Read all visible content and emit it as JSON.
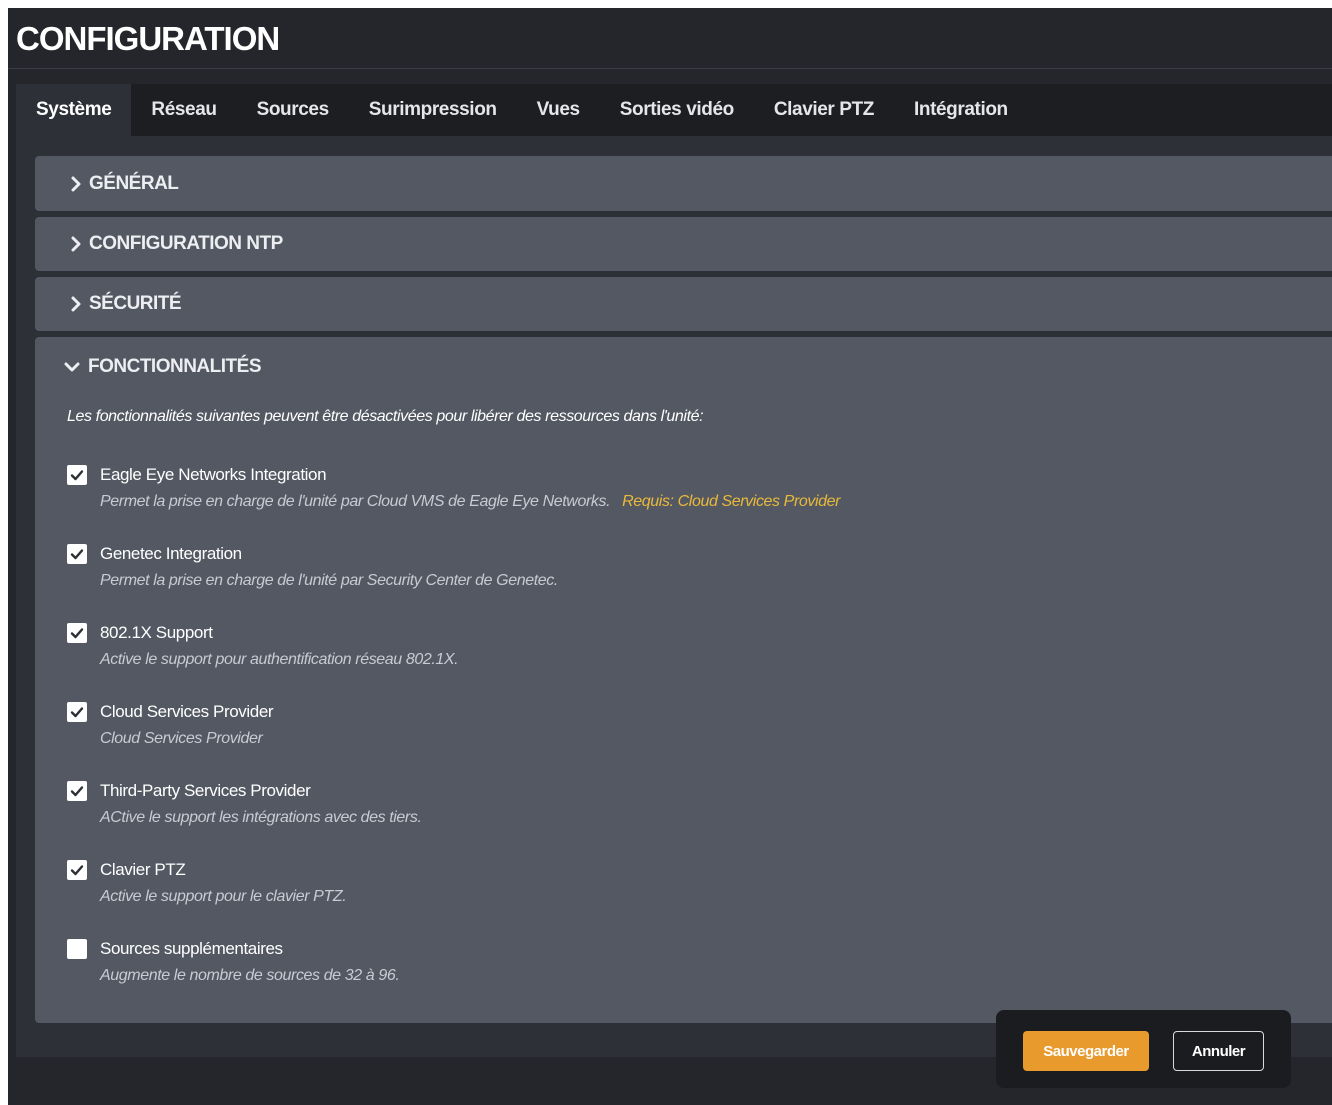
{
  "header": {
    "title": "CONFIGURATION"
  },
  "tabs": [
    {
      "label": "Système",
      "active": true
    },
    {
      "label": "Réseau"
    },
    {
      "label": "Sources"
    },
    {
      "label": "Surimpression"
    },
    {
      "label": "Vues"
    },
    {
      "label": "Sorties vidéo"
    },
    {
      "label": "Clavier PTZ"
    },
    {
      "label": "Intégration"
    }
  ],
  "sections": {
    "general": {
      "title": "GÉNÉRAL",
      "icon": "chevron-right-icon",
      "expanded": false
    },
    "ntp": {
      "title": "CONFIGURATION NTP",
      "icon": "chevron-right-icon",
      "expanded": false
    },
    "security": {
      "title": "SÉCURITÉ",
      "icon": "chevron-right-icon",
      "expanded": false
    },
    "features": {
      "title": "FONCTIONNALITÉS",
      "icon": "chevron-down-icon",
      "expanded": true,
      "intro": "Les fonctionnalités suivantes peuvent être désactivées pour libérer des ressources dans l'unité:",
      "items": [
        {
          "label": "Eagle Eye Networks Integration",
          "checked": true,
          "description": "Permet la prise en charge de l'unité par Cloud VMS de Eagle Eye Networks.",
          "requirement": "Requis: Cloud Services Provider"
        },
        {
          "label": "Genetec Integration",
          "checked": true,
          "description": "Permet la prise en charge de l'unité par Security Center de Genetec."
        },
        {
          "label": "802.1X Support",
          "checked": true,
          "description": "Active le support pour authentification réseau 802.1X."
        },
        {
          "label": "Cloud Services Provider",
          "checked": true,
          "description": "Cloud Services Provider"
        },
        {
          "label": "Third-Party Services Provider",
          "checked": true,
          "description": "ACtive le support les intégrations avec des tiers."
        },
        {
          "label": "Clavier PTZ",
          "checked": true,
          "description": "Active le support pour le clavier PTZ."
        },
        {
          "label": "Sources supplémentaires",
          "checked": false,
          "description": "Augmente le nombre de sources de 32 à 96."
        }
      ]
    }
  },
  "actions": {
    "save_label": "Sauvegarder",
    "cancel_label": "Annuler"
  },
  "colors": {
    "accent": "#e99a2c",
    "requirement": "#e9b93b",
    "panel": "#535862",
    "background": "#24262b"
  }
}
